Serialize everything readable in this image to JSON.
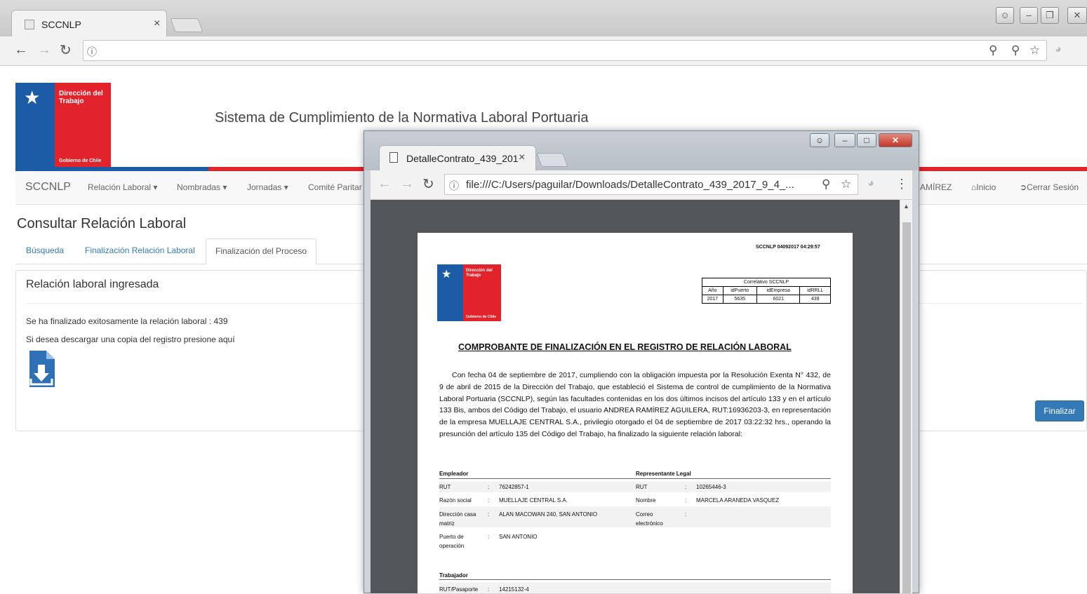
{
  "outer_browser": {
    "tab_title": "SCCNLP",
    "tab_close": "×"
  },
  "site": {
    "logo_line1": "Dirección del Trabajo",
    "logo_line2": "Gobierno de Chile",
    "system_title": "Sistema de Cumplimiento de la Normativa Laboral Portuaria"
  },
  "navbar": {
    "brand": "SCCNLP",
    "items": [
      "Relación Laboral",
      "Nombradas",
      "Jornadas",
      "Comité Paritar"
    ],
    "user_partial": "AMÍREZ",
    "inicio": "Inicio",
    "cerrar_sesion": "Cerrar Sesión"
  },
  "page": {
    "heading": "Consultar Relación Laboral",
    "tabs": [
      "Búsqueda",
      "Finalización Relación Laboral",
      "Finalización del Proceso"
    ],
    "panel_title": "Relación laboral ingresada",
    "msg_success_prefix": "Se ha finalizado exitosamente la relación laboral : ",
    "relacion_id": "439",
    "msg_download": "Si desea descargar una copia del registro presione aquí",
    "finalizar_button": "Finalizar"
  },
  "popup": {
    "tab_title": "DetalleContrato_439_201",
    "tab_close": "×",
    "url": "file:///C:/Users/paguilar/Downloads/DetalleContrato_439_2017_9_4_..."
  },
  "pdf": {
    "stamp": "SCCNLP 04092017 04:29:57",
    "logo_line1": "Dirección del Trabajo",
    "logo_line2": "Gobierno de Chile",
    "correlativo_title": "Correlativo SCCNLP",
    "correlativo_headers": [
      "Año",
      "idPuerto",
      "idEmpresa",
      "idRRLL"
    ],
    "correlativo_values": [
      "2017",
      "5635",
      "6021",
      "439"
    ],
    "heading": "COMPROBANTE DE FINALIZACIÓN EN EL REGISTRO DE RELACIÓN LABORAL",
    "body": "Con fecha 04 de septiembre de 2017, cumpliendo con la obligación impuesta por la Resolución Exenta N° 432, de 9 de abril de 2015 de la Dirección del Trabajo, que estableció el Sistema de control de cumplimiento de la Normativa Laboral Portuaria (SCCNLP), según las facultades contenidas en los dos últimos incisos del artículo 133 y en el artículo 133 Bis, ambos del Código del Trabajo, el usuario ANDREA RAMÍREZ AGUILERA, RUT:16936203-3, en representación de la empresa MUELLAJE CENTRAL S.A., privilegio otorgado el 04 de septiembre de 2017 03:22:32 hrs., operando la presunción del artículo 135 del Código del Trabajo, ha finalizado la siguiente relación laboral:",
    "empleador": {
      "title": "Empleador",
      "rut_label": "RUT",
      "rut": "76242857-1",
      "razon_label": "Razón social",
      "razon": "MUELLAJE CENTRAL S.A.",
      "dir_label": "Dirección casa matriz",
      "dir": "ALAN MACOWAN 240, SAN ANTONIO",
      "puerto_label": "Puerto de operación",
      "puerto": "SAN ANTONIO"
    },
    "representante": {
      "title": "Representante Legal",
      "rut_label": "RUT",
      "rut": "10265446-3",
      "nombre_label": "Nombre",
      "nombre": "MARCELA ARANEDA VASQUEZ",
      "correo_label": "Correo electrónico",
      "correo": ""
    },
    "trabajador": {
      "title": "Trabajador",
      "rut_label": "RUT/Pasaporte",
      "rut": "14215132-4"
    },
    "colon": ":"
  }
}
